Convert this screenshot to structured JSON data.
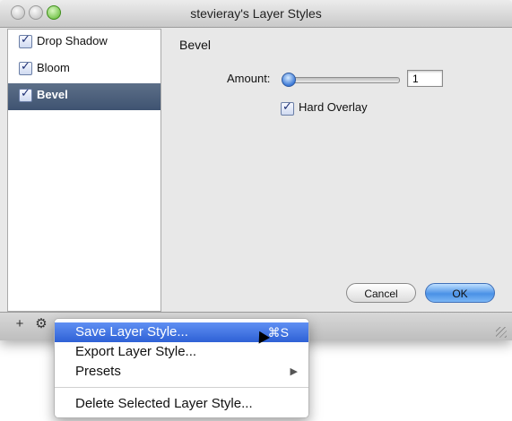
{
  "window": {
    "title": "stevieray's Layer Styles"
  },
  "sidebar": {
    "items": [
      {
        "label": "Drop Shadow",
        "checked": true,
        "selected": false
      },
      {
        "label": "Bloom",
        "checked": true,
        "selected": false
      },
      {
        "label": "Bevel",
        "checked": true,
        "selected": true
      }
    ]
  },
  "panel": {
    "title": "Bevel",
    "amount_label": "Amount:",
    "amount_value": "1",
    "slider_fraction": 0.0,
    "hard_overlay_label": "Hard Overlay",
    "hard_overlay_checked": true
  },
  "buttons": {
    "cancel": "Cancel",
    "ok": "OK"
  },
  "toolbar": {
    "add_glyph": "+",
    "gear_glyph": "⚙"
  },
  "menu": {
    "items": [
      {
        "label": "Save Layer Style...",
        "shortcut": "⌘S",
        "highlighted": true
      },
      {
        "label": "Export Layer Style...",
        "shortcut": "",
        "highlighted": false
      },
      {
        "label": "Presets",
        "shortcut": "",
        "submenu_arrow": "▶",
        "highlighted": false
      },
      {
        "label": "Delete Selected Layer Style...",
        "shortcut": "",
        "highlighted": false
      }
    ]
  },
  "colors": {
    "selection": "#3f5371",
    "menu_highlight": "#2e61d5",
    "default_button": "#4a91e6"
  }
}
